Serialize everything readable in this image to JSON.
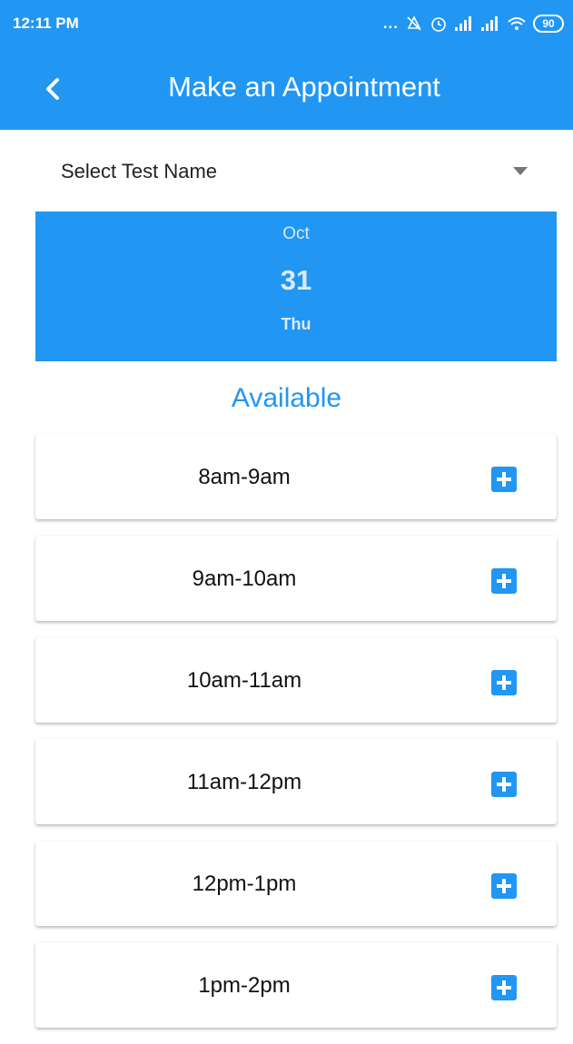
{
  "status_bar": {
    "time": "12:11 PM",
    "dots": "...",
    "battery": "90"
  },
  "header": {
    "title": "Make an Appointment"
  },
  "test_select": {
    "label": "Select Test Name"
  },
  "date": {
    "month": "Oct",
    "day": "31",
    "weekday": "Thu"
  },
  "available_label": "Available",
  "slots": [
    {
      "label": "8am-9am"
    },
    {
      "label": "9am-10am"
    },
    {
      "label": "10am-11am"
    },
    {
      "label": "11am-12pm"
    },
    {
      "label": "12pm-1pm"
    },
    {
      "label": "1pm-2pm"
    }
  ],
  "colors": {
    "primary": "#2196f3",
    "background": "#ffffff"
  },
  "icons": {
    "back": "chevron-left-icon",
    "dropdown": "caret-down-icon",
    "add": "plus-square-icon"
  }
}
